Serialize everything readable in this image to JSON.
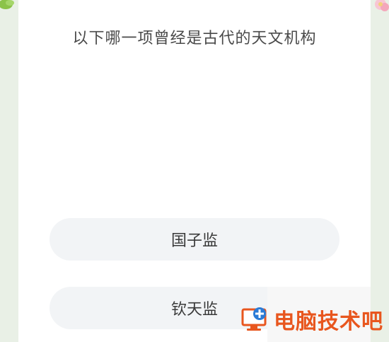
{
  "quiz": {
    "question": "以下哪一项曾经是古代的天文机构",
    "options": [
      {
        "label": "国子监"
      },
      {
        "label": "钦天监"
      }
    ]
  },
  "watermark": {
    "text": "电脑技术吧",
    "icon": "monitor-plus-logo",
    "color": "#e8561e"
  },
  "colors": {
    "background": "#e9f0e6",
    "card": "#ffffff",
    "option_bg": "#f2f4f6",
    "question_text": "#4a4a4a"
  }
}
